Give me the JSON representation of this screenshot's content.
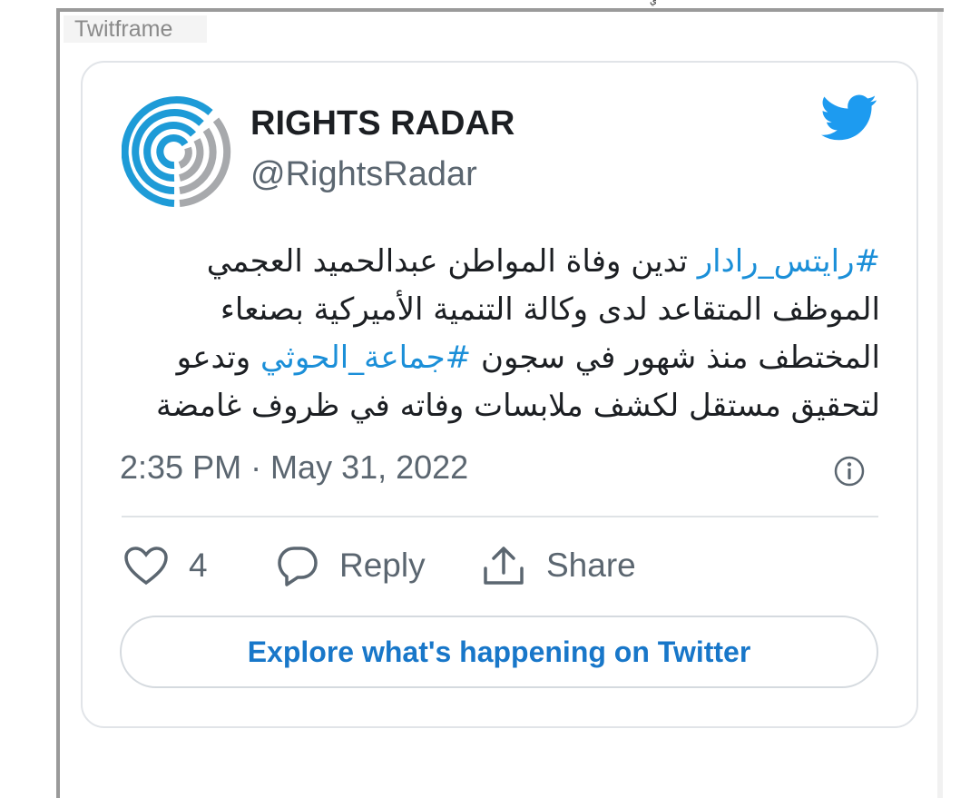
{
  "frame": {
    "label": "Twitframe",
    "top_mark": "ي"
  },
  "tweet": {
    "author_name": "RIGHTS RADAR",
    "author_handle": "@RightsRadar",
    "hashtag_1": "#رايتس_رادار",
    "text_part_1": " تدين وفاة المواطن عبدالحميد العجمي الموظف المتقاعد لدى وكالة  التنمية الأميركية بصنعاء المختطف منذ شهور في سجون ",
    "hashtag_2": "#جماعة_الحوثي",
    "text_part_2": " وتدعو لتحقيق مستقل لكشف ملابسات وفاته في ظروف غامضة",
    "timestamp": "2:35 PM · May 31, 2022"
  },
  "actions": {
    "like_count": "4",
    "reply_label": "Reply",
    "share_label": "Share"
  },
  "explore_label": "Explore what's happening on Twitter",
  "colors": {
    "link": "#1b8fd8",
    "twitter_blue": "#1d9bf0",
    "explore_text": "#1877c9",
    "logo_blue": "#1e9bd7",
    "logo_gray": "#a7a9ac"
  },
  "icons": [
    "rights-radar-logo",
    "twitter-bird-icon",
    "info-icon",
    "heart-icon",
    "reply-bubble-icon",
    "share-icon"
  ]
}
